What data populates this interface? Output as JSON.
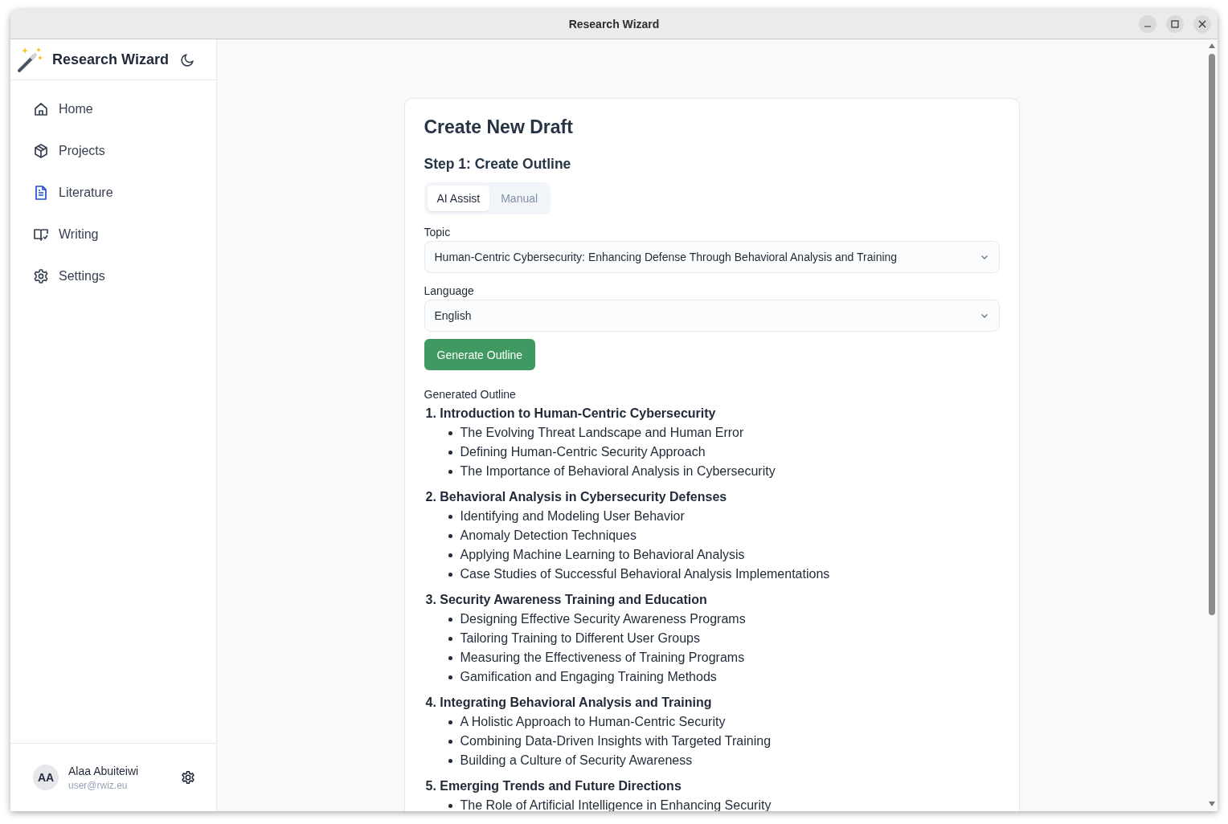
{
  "window": {
    "title": "Research Wizard"
  },
  "sidebar": {
    "app_name": "Research Wizard",
    "items": [
      {
        "label": "Home",
        "selected": false
      },
      {
        "label": "Projects",
        "selected": false
      },
      {
        "label": "Literature",
        "selected": true
      },
      {
        "label": "Writing",
        "selected": false
      },
      {
        "label": "Settings",
        "selected": false
      }
    ],
    "user": {
      "initials": "AA",
      "name": "Alaa Abuiteiwi",
      "email": "user@rwiz.eu"
    }
  },
  "card": {
    "title": "Create New Draft",
    "step": "Step 1: Create Outline",
    "tabs": [
      {
        "label": "AI Assist",
        "selected": true
      },
      {
        "label": "Manual",
        "selected": false
      }
    ],
    "fields": [
      {
        "label": "Topic",
        "value": "Human-Centric Cybersecurity: Enhancing Defense Through Behavioral Analysis and Training"
      },
      {
        "label": "Language",
        "value": "English"
      }
    ],
    "button": "Generate Outline",
    "outline_label": "Generated Outline",
    "outline": [
      {
        "number": "1.",
        "title": "Introduction to Human-Centric Cybersecurity",
        "items": [
          "The Evolving Threat Landscape and Human Error",
          "Defining Human-Centric Security Approach",
          "The Importance of Behavioral Analysis in Cybersecurity"
        ]
      },
      {
        "number": "2.",
        "title": "Behavioral Analysis in Cybersecurity Defenses",
        "items": [
          "Identifying and Modeling User Behavior",
          "Anomaly Detection Techniques",
          "Applying Machine Learning to Behavioral Analysis",
          "Case Studies of Successful Behavioral Analysis Implementations"
        ]
      },
      {
        "number": "3.",
        "title": "Security Awareness Training and Education",
        "items": [
          "Designing Effective Security Awareness Programs",
          "Tailoring Training to Different User Groups",
          "Measuring the Effectiveness of Training Programs",
          "Gamification and Engaging Training Methods"
        ]
      },
      {
        "number": "4.",
        "title": "Integrating Behavioral Analysis and Training",
        "items": [
          "A Holistic Approach to Human-Centric Security",
          "Combining Data-Driven Insights with Targeted Training",
          "Building a Culture of Security Awareness"
        ]
      },
      {
        "number": "5.",
        "title": "Emerging Trends and Future Directions",
        "items": [
          "The Role of Artificial Intelligence in Enhancing Security"
        ]
      }
    ]
  }
}
